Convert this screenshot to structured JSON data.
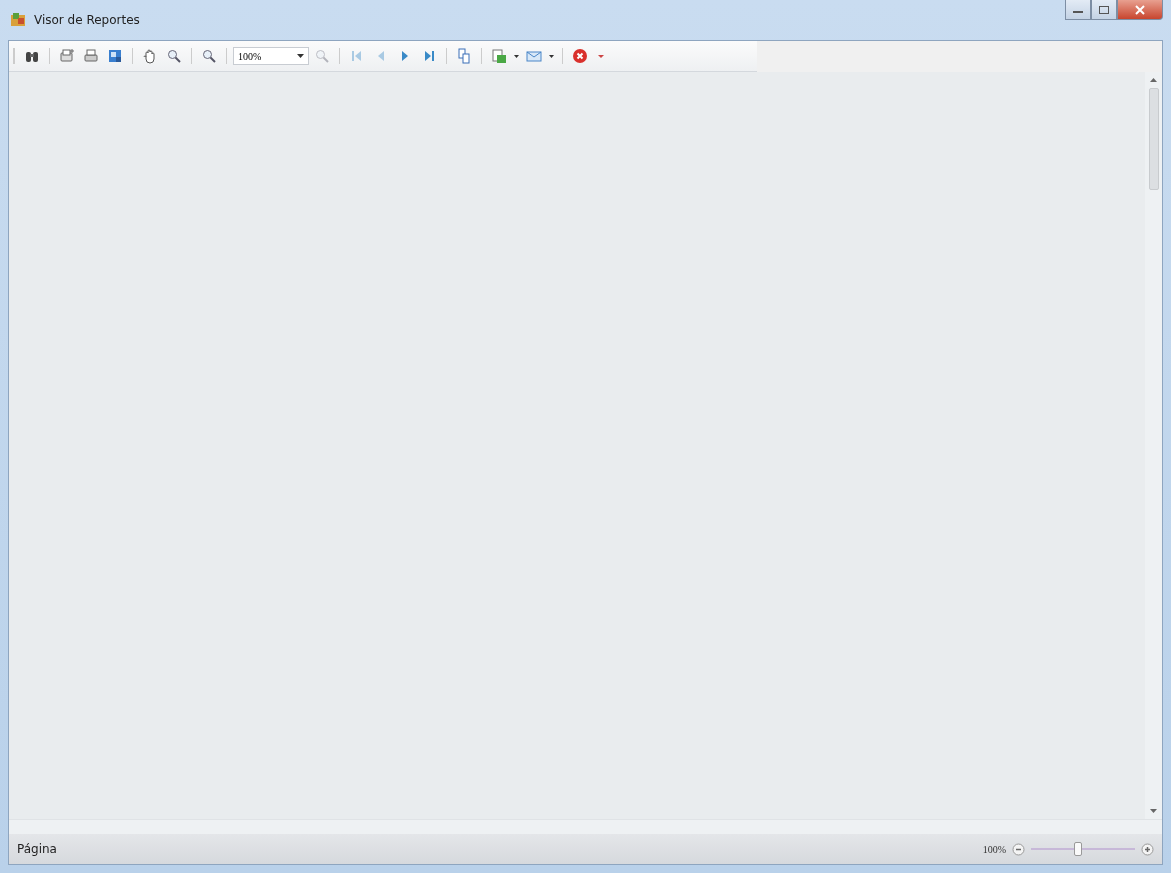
{
  "window": {
    "title": "Visor de Reportes"
  },
  "toolbar": {
    "zoom_value": "100%",
    "buttons": [
      {
        "disabled": false
      },
      {
        "disabled": false
      },
      {
        "disabled": false
      },
      {
        "disabled": false
      },
      {
        "disabled": false
      },
      {
        "disabled": false
      },
      {
        "disabled": false
      },
      {
        "disabled": true
      },
      {
        "disabled": true
      },
      {
        "disabled": true
      },
      {
        "disabled": false
      },
      {
        "disabled": false
      },
      {
        "disabled": false
      },
      {
        "disabled": false
      },
      {
        "disabled": false
      },
      {
        "disabled": false
      }
    ]
  },
  "status_bar": {
    "page_label": "Página",
    "zoom_label": "100%",
    "zoom_slider": {
      "level": 0.45
    }
  }
}
